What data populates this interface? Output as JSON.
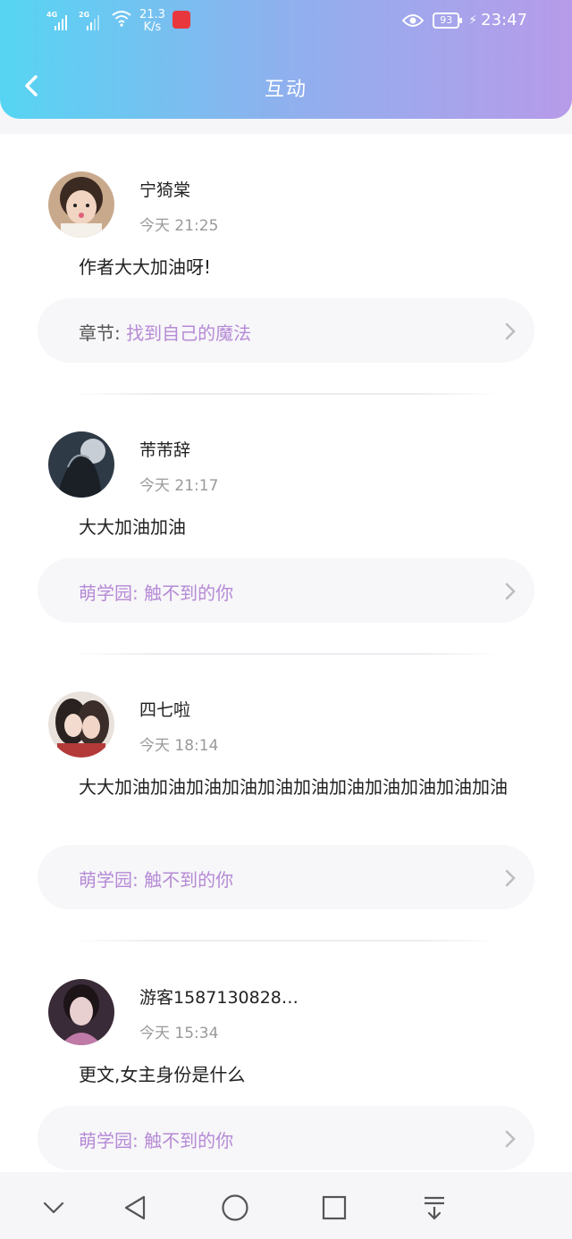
{
  "status_bar": {
    "network1": "4G",
    "network2": "2G",
    "speed_value": "21.3",
    "speed_unit": "K/s",
    "battery": "93",
    "time": "23:47"
  },
  "header": {
    "title": "互动",
    "back_icon": "chevron-left-icon"
  },
  "comments": [
    {
      "name": "宁猗棠",
      "time": "今天 21:25",
      "text": "作者大大加油呀!",
      "chip_prefix": "章节:",
      "chip_title": "找到自己的魔法",
      "chip_prefix_color": "#555555"
    },
    {
      "name": "芾芾辞",
      "time": "今天 21:17",
      "text": "大大加油加油",
      "chip_prefix": "萌学园:",
      "chip_title": "触不到的你",
      "chip_prefix_color": "#b58ad6"
    },
    {
      "name": "四七啦",
      "time": "今天 18:14",
      "text": "大大加油加油加油加油加油加油加油加油加油加油加油",
      "chip_prefix": "萌学园:",
      "chip_title": "触不到的你",
      "chip_prefix_color": "#b58ad6"
    },
    {
      "name": "游客1587130828…",
      "time": "今天 15:34",
      "text": "更文,女主身份是什么",
      "chip_prefix": "萌学园:",
      "chip_title": "触不到的你",
      "chip_prefix_color": "#b58ad6"
    }
  ],
  "nav_bar": {
    "items": [
      "chevron-down-icon",
      "back-triangle-icon",
      "home-circle-icon",
      "recents-square-icon",
      "download-menu-icon"
    ]
  },
  "colors": {
    "accent": "#b58ad6",
    "header_gradient_start": "#56d5f3",
    "header_gradient_end": "#b79be9"
  }
}
